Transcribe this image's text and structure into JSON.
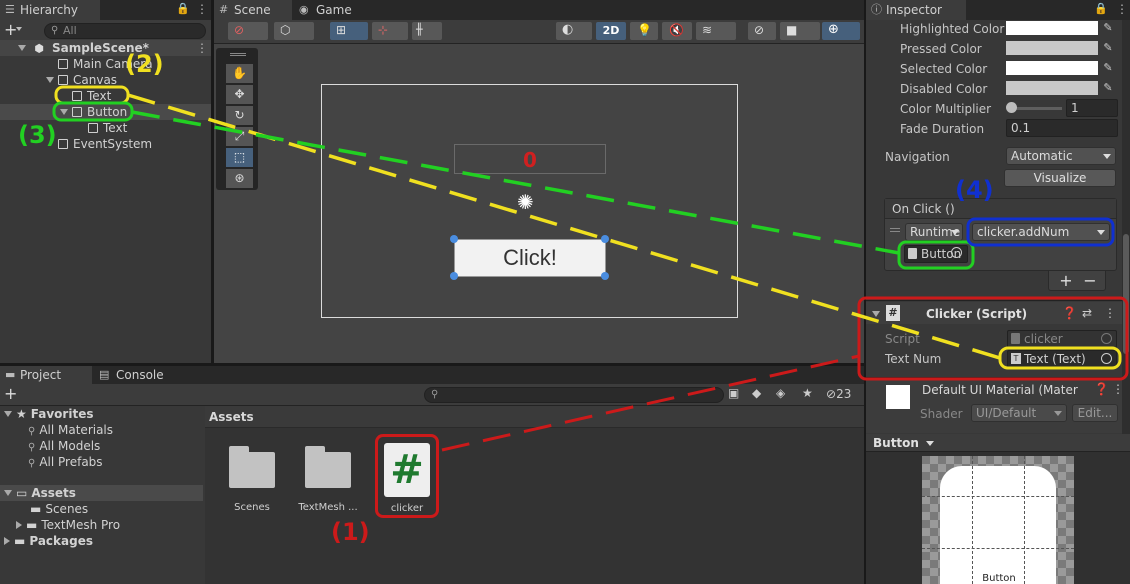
{
  "hierarchy": {
    "tab": "Hierarchy",
    "search_placeholder": "All",
    "scene": "SampleScene*",
    "items": [
      "Main Camera",
      "Canvas",
      "Text",
      "Button",
      "Text",
      "EventSystem"
    ]
  },
  "scene_view": {
    "tab_scene": "Scene",
    "tab_game": "Game",
    "mode_2d": "2D",
    "counter_text": "0",
    "button_text": "Click!"
  },
  "inspector": {
    "tab": "Inspector",
    "color_rows": [
      "Highlighted Color",
      "Pressed Color",
      "Selected Color",
      "Disabled Color"
    ],
    "color_multiplier_label": "Color Multiplier",
    "color_multiplier_value": "1",
    "fade_duration_label": "Fade Duration",
    "fade_duration_value": "0.1",
    "navigation_label": "Navigation",
    "navigation_value": "Automatic",
    "visualize_button": "Visualize",
    "onclick_title": "On Click ()",
    "onclick_runtime": "Runtime",
    "onclick_function": "clicker.addNum",
    "onclick_object": "Button",
    "add_button": "+",
    "remove_button": "−",
    "script_component_title": "Clicker (Script)",
    "script_label": "Script",
    "script_value": "clicker",
    "textnum_label": "Text Num",
    "textnum_value": "Text (Text)",
    "material_title": "Default UI Material (Mater",
    "shader_label": "Shader",
    "shader_value": "UI/Default",
    "edit_button": "Edit...",
    "preview_title": "Button",
    "preview_caption": "Button"
  },
  "project": {
    "tab_project": "Project",
    "tab_console": "Console",
    "favorites_label": "Favorites",
    "favorites": [
      "All Materials",
      "All Models",
      "All Prefabs"
    ],
    "assets_label": "Assets",
    "asset_folders": [
      "Scenes",
      "TextMesh Pro"
    ],
    "packages_label": "Packages",
    "breadcrumb": "Assets",
    "assets": [
      "Scenes",
      "TextMesh ...",
      "clicker"
    ],
    "badge_count": "23",
    "script_glyph": "#"
  },
  "annotations": {
    "n1": "(1)",
    "n2": "(2)",
    "n3": "(3)",
    "n4": "(4)"
  },
  "colors": {
    "red": "#cc1a1a",
    "yellow": "#f0e020",
    "green": "#22d022",
    "blue": "#1030d0"
  }
}
